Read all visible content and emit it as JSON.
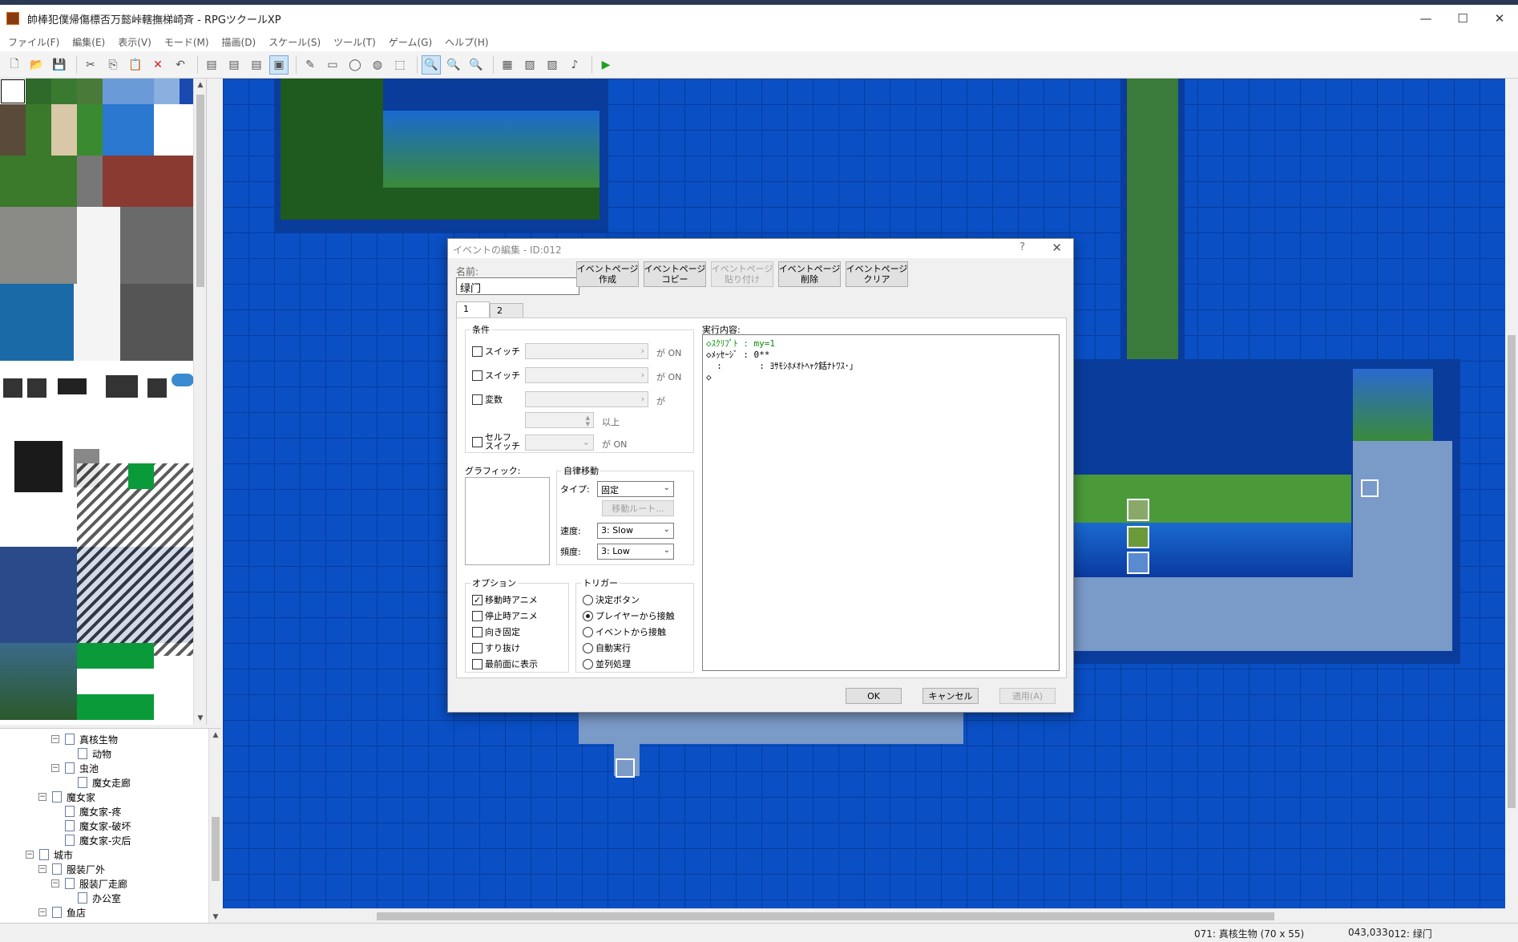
{
  "window": {
    "title": "帥棒犯僕帰傷標否万懿峠轄撫梯崎斉 - RPGツクールXP",
    "controls": {
      "minimize": "—",
      "maximize": "☐",
      "close": "✕"
    }
  },
  "menu": [
    "ファイル(F)",
    "編集(E)",
    "表示(V)",
    "モード(M)",
    "描画(D)",
    "スケール(S)",
    "ツール(T)",
    "ゲーム(G)",
    "ヘルプ(H)"
  ],
  "toolbar": {
    "icons": [
      "new-project-icon",
      "open-project-icon",
      "save-icon",
      "cut-icon",
      "copy-icon",
      "paste-icon",
      "delete-icon",
      "undo-icon",
      "layer1-icon",
      "layer2-icon",
      "layer3-icon",
      "event-layer-icon",
      "pencil-icon",
      "rectangle-icon",
      "ellipse-icon",
      "fill-icon",
      "select-icon",
      "zoom-1-icon",
      "zoom-2-icon",
      "zoom-4-icon",
      "database-icon",
      "materialbase-icon",
      "script-editor-icon",
      "sound-test-icon",
      "playtest-icon"
    ],
    "glyphs": [
      "🗋",
      "📂",
      "💾",
      "✂",
      "⎘",
      "📋",
      "✕",
      "↶",
      "▤",
      "▤",
      "▤",
      "▣",
      "✎",
      "▭",
      "◯",
      "◍",
      "⬚",
      "🔍",
      "🔍",
      "🔍",
      "▦",
      "▧",
      "▨",
      "♪",
      "▶"
    ]
  },
  "map_tree": [
    {
      "label": "真核生物",
      "indent": 3,
      "toggle": "⊟"
    },
    {
      "label": "动物",
      "indent": 4,
      "toggle": ""
    },
    {
      "label": "虫池",
      "indent": 3,
      "toggle": "⊟"
    },
    {
      "label": "魔女走廊",
      "indent": 4,
      "toggle": ""
    },
    {
      "label": "魔女家",
      "indent": 2,
      "toggle": "⊟"
    },
    {
      "label": "魔女家-疼",
      "indent": 3,
      "toggle": ""
    },
    {
      "label": "魔女家-破坏",
      "indent": 3,
      "toggle": ""
    },
    {
      "label": "魔女家-灾后",
      "indent": 3,
      "toggle": ""
    },
    {
      "label": "城市",
      "indent": 1,
      "toggle": "⊟"
    },
    {
      "label": "服装厂外",
      "indent": 2,
      "toggle": "⊟"
    },
    {
      "label": "服装厂走廊",
      "indent": 3,
      "toggle": "⊟"
    },
    {
      "label": "办公室",
      "indent": 4,
      "toggle": ""
    },
    {
      "label": "鱼店",
      "indent": 2,
      "toggle": "⊟"
    }
  ],
  "status": {
    "map": "071: 真核生物 (70 x 55)",
    "coords": "043,033",
    "event": "012: 绿门"
  },
  "dialog": {
    "title": "イベントの編集 - ID:012",
    "help": "?",
    "close": "✕",
    "name_label": "名前:",
    "name_value": "绿门",
    "page_buttons": [
      {
        "label": "イベントページ\n作成",
        "disabled": false
      },
      {
        "label": "イベントページ\nコピー",
        "disabled": false
      },
      {
        "label": "イベントページ\n貼り付け",
        "disabled": true
      },
      {
        "label": "イベントページ\n削除",
        "disabled": false
      },
      {
        "label": "イベントページ\nクリア",
        "disabled": false
      }
    ],
    "tabs": [
      "1",
      "2"
    ],
    "conditions": {
      "title": "条件",
      "switch1": "スイッチ",
      "switch2": "スイッチ",
      "variable": "変数",
      "self_switch": "セルフ\nスイッチ",
      "on_text": "が ON",
      "ga_text": "が",
      "ijou_text": "以上"
    },
    "graphic_label": "グラフィック:",
    "autonomous": {
      "title": "自律移動",
      "type_label": "タイプ:",
      "type_value": "固定",
      "route_button": "移動ルート...",
      "speed_label": "速度:",
      "speed_value": "3: Slow",
      "freq_label": "頻度:",
      "freq_value": "3: Low"
    },
    "options": {
      "title": "オプション",
      "items": [
        {
          "label": "移動時アニメ",
          "checked": true
        },
        {
          "label": "停止時アニメ",
          "checked": false
        },
        {
          "label": "向き固定",
          "checked": false
        },
        {
          "label": "すり抜け",
          "checked": false
        },
        {
          "label": "最前面に表示",
          "checked": false
        }
      ]
    },
    "trigger": {
      "title": "トリガー",
      "items": [
        {
          "label": "決定ボタン",
          "selected": false
        },
        {
          "label": "プレイヤーから接触",
          "selected": true
        },
        {
          "label": "イベントから接触",
          "selected": false
        },
        {
          "label": "自動実行",
          "selected": false
        },
        {
          "label": "並列処理",
          "selected": false
        }
      ]
    },
    "commands_label": "実行内容:",
    "commands": [
      {
        "text": "◇ｽｸﾘﾌﾟﾄ : my=1",
        "color": "green"
      },
      {
        "text": "◇ﾒｯｾｰｼﾞ : 0**",
        "color": "black"
      },
      {
        "text": "  :       : ﾖｻﾓｼﾎﾒｵﾄﾍｬｸ銛ﾅﾄﾜｽ･｣",
        "color": "black"
      },
      {
        "text": "◇",
        "color": "black"
      }
    ],
    "ok": "OK",
    "cancel": "キャンセル",
    "apply": "適用(A)"
  }
}
